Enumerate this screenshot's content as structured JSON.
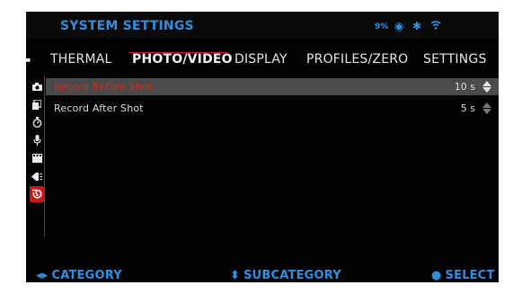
{
  "header": {
    "title": "SYSTEM SETTINGS",
    "battery": "9%",
    "status_icons": [
      "record-icon",
      "bluetooth-icon",
      "wifi-icon"
    ]
  },
  "tabs": [
    {
      "label": "THERMAL",
      "active": false
    },
    {
      "label": "PHOTO/VIDEO",
      "active": true
    },
    {
      "label": "DISPLAY",
      "active": false
    },
    {
      "label": "PROFILES/ZERO",
      "active": false
    },
    {
      "label": "SETTINGS",
      "active": false
    }
  ],
  "sidebar": {
    "icons": [
      "camera-icon",
      "gallery-icon",
      "stopwatch-icon",
      "microphone-icon",
      "film-icon",
      "recoil-icon",
      "shot-record-icon"
    ],
    "active_index": 6
  },
  "settings": [
    {
      "label": "Record Before Shot",
      "value": "10 s",
      "selected": true
    },
    {
      "label": "Record After Shot",
      "value": "5 s",
      "selected": false
    }
  ],
  "footer": {
    "category": "CATEGORY",
    "subcategory": "SUBCATEGORY",
    "select": "SELECT"
  },
  "colors": {
    "accent_blue": "#2f8fe0",
    "accent_red": "#c41a1a",
    "background": "#020202",
    "selected_row": "#4a4a4a"
  }
}
